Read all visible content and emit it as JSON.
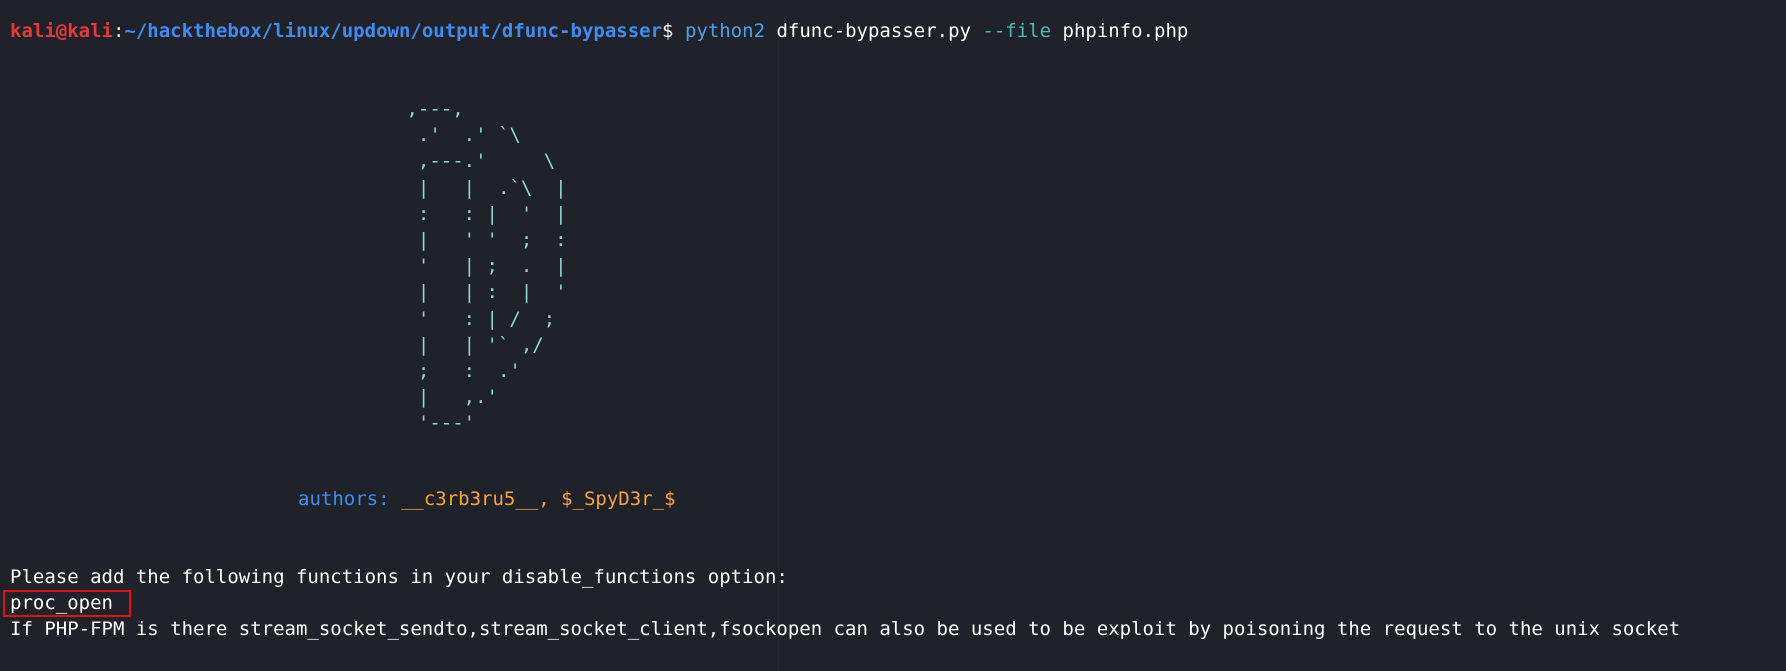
{
  "prompt": {
    "user_host": "kali@kali",
    "colon": ":",
    "path": "~/hackthebox/linux/updown/output/dfunc-bypasser",
    "dollar": "$"
  },
  "command": {
    "binary": "python2",
    "script": "dfunc-bypasser.py",
    "flag": "--file",
    "argument": "phpinfo.php"
  },
  "banner_art": " ,---,\n  .'  .' `\\\n  ,---.'     \\\n  |   |  .`\\  |\n  :   : |  '  |\n  |   ' '  ;  :\n  '   | ;  .  |\n  |   | :  |  '\n  '   : | /  ;\n  |   | '` ,/\n  ;   :  .'\n  |   ,.'\n  '---'",
  "authors": {
    "label": "authors:",
    "names": "__c3rb3ru5__, $_SpyD3r_$"
  },
  "output": {
    "line1": "Please add the following functions in your disable_functions option:",
    "line2": "proc_open",
    "line3": "If PHP-FPM is there stream_socket_sendto,stream_socket_client,fsockopen can also be used to be exploit by poisoning the request to the unix socket"
  },
  "colors": {
    "background": "#1f2229",
    "user": "#e8363c",
    "path": "#3b8ef0",
    "banner": "#8fd7cf",
    "authors_names": "#f7a43b",
    "highlight_box": "#e00f1a"
  }
}
